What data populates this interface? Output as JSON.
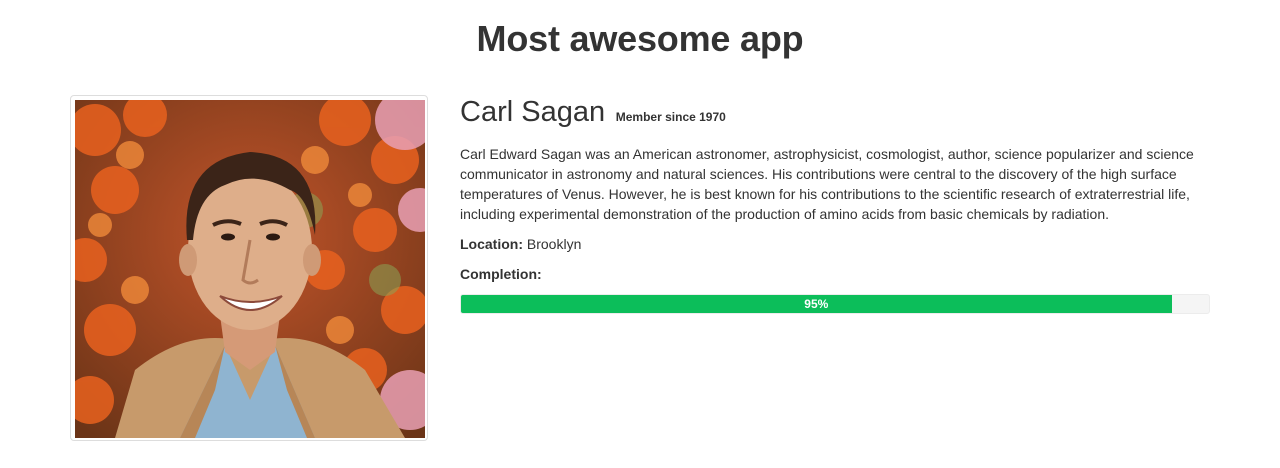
{
  "app": {
    "title": "Most awesome app"
  },
  "profile": {
    "name": "Carl Sagan",
    "member_since": "Member since 1970",
    "bio": "Carl Edward Sagan was an American astronomer, astrophysicist, cosmologist, author, science popularizer and science communicator in astronomy and natural sciences. His contributions were central to the discovery of the high surface temperatures of Venus. However, he is best known for his contributions to the scientific research of extraterrestrial life, including experimental demonstration of the production of amino acids from basic chemicals by radiation.",
    "location_label": "Location:",
    "location_value": "Brooklyn",
    "completion_label": "Completion:",
    "completion_percent": 95,
    "completion_text": "95%"
  },
  "colors": {
    "progress": "#0cbe5a",
    "progress_track": "#f5f5f5",
    "text": "#333333"
  }
}
